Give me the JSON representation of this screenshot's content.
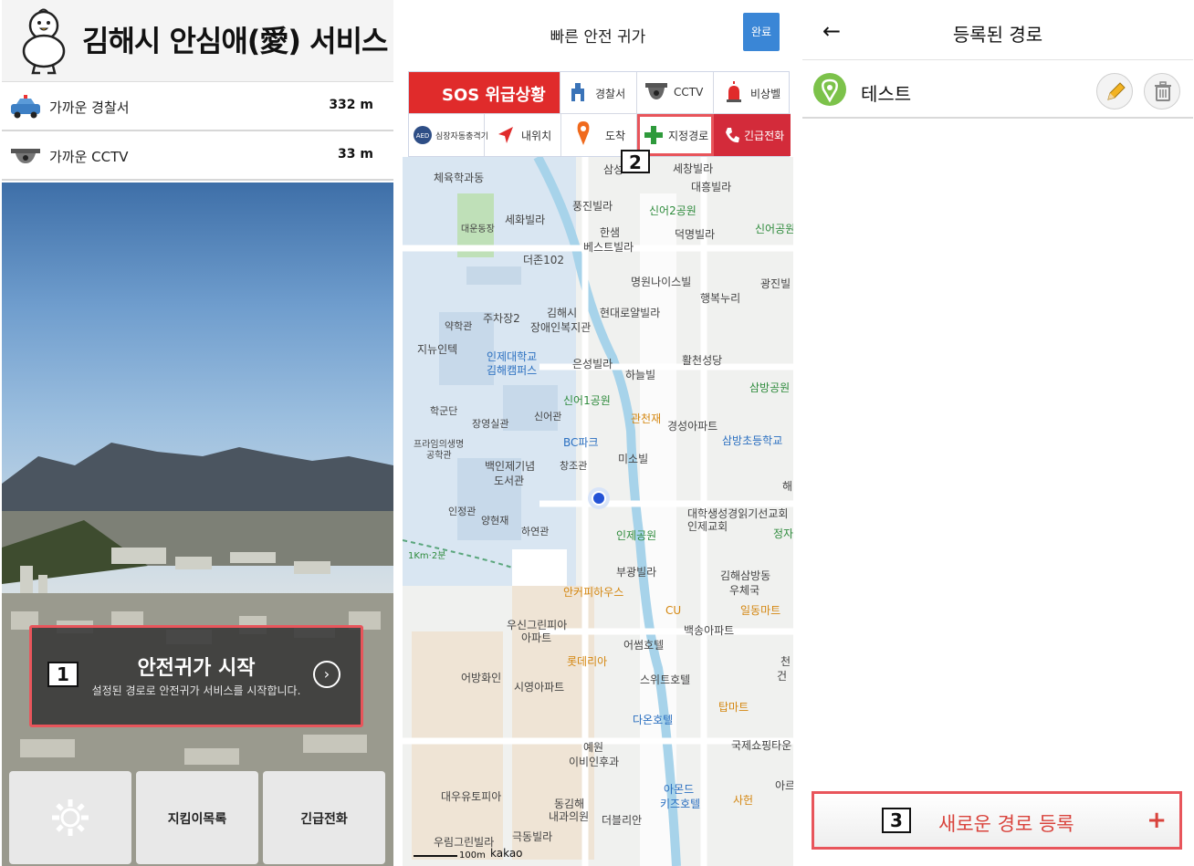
{
  "panel1": {
    "title": "김해시 안심애(愛) 서비스",
    "nearby": [
      {
        "label": "가까운 경찰서",
        "distance": "332 m",
        "icon": "police-car-icon"
      },
      {
        "label": "가까운 CCTV",
        "distance": "33 m",
        "icon": "cctv-icon"
      }
    ],
    "start_card": {
      "title": "안전귀가 시작",
      "subtitle": "설정된 경로로 안전귀가 서비스를 시작합니다.",
      "marker": "1"
    },
    "bottom_buttons": [
      {
        "label": "",
        "icon": "settings-gear-icon"
      },
      {
        "label": "지킴이목록"
      },
      {
        "label": "긴급전화"
      }
    ]
  },
  "panel2": {
    "title": "빠른 안전 귀가",
    "done_label": "완료",
    "toolbar_row1": [
      {
        "label": "SOS 위급상황",
        "icon": ""
      },
      {
        "label": "경찰서",
        "icon": "police-station-icon"
      },
      {
        "label": "CCTV",
        "icon": "cctv-icon"
      },
      {
        "label": "비상벨",
        "icon": "siren-icon"
      }
    ],
    "toolbar_row2": [
      {
        "label": "심장자동충격기",
        "icon": "aed-icon"
      },
      {
        "label": "내위치",
        "icon": "location-arrow-icon"
      },
      {
        "label": "도착",
        "icon": "destination-pin-icon"
      },
      {
        "label": "지정경로",
        "icon": "plus-icon"
      },
      {
        "label": "긴급전화",
        "icon": "phone-icon"
      }
    ],
    "marker": "2",
    "map_labels": [
      "체육학과동",
      "삼성",
      "세창빌라",
      "대흥빌라",
      "풍진빌라",
      "신어2공원",
      "세화빌라",
      "대운동장",
      "한샘",
      "베스트빌라",
      "덕명빌라",
      "신어공원",
      "더존102",
      "명원나이스빌",
      "광진빌",
      "행복누리",
      "주차장2",
      "김해시",
      "장애인복지관",
      "현대로얄빌라",
      "약학관",
      "지뉴인텍",
      "인제대학교",
      "김해캠퍼스",
      "은성빌라",
      "하늘빌",
      "활천성당",
      "삼방공원",
      "신어1공원",
      "학군단",
      "관천재",
      "경성아파트",
      "신어관",
      "장영실관",
      "BC파크",
      "삼방초등학교",
      "프라임의생명",
      "공학관",
      "백인제기념",
      "도서관",
      "창조관",
      "미소빌",
      "인정관",
      "양현재",
      "하연관",
      "대학생성경읽기선교회",
      "인제교회",
      "정자",
      "인제공원",
      "부광빌라",
      "김해삼방동",
      "우체국",
      "안커피하우스",
      "CU",
      "일동마트",
      "우신그린피아",
      "아파트",
      "백송아파트",
      "어썸호텔",
      "롯데리아",
      "어방화인",
      "시영아파트",
      "스위트호텔",
      "천",
      "건",
      "탑마트",
      "다온호텔",
      "국제쇼핑타운",
      "예원",
      "이비인후과",
      "아몬드",
      "키즈호텔",
      "사헌",
      "대우유토피아",
      "동김해",
      "내과의원",
      "더블리안",
      "우림그린빌라",
      "극동빌라",
      "100m",
      "kakao",
      "해",
      "아르",
      "1Km·2분"
    ]
  },
  "panel3": {
    "title": "등록된 경로",
    "route": {
      "name": "테스트"
    },
    "new_route_label": "새로운 경로 등록",
    "marker": "3"
  }
}
